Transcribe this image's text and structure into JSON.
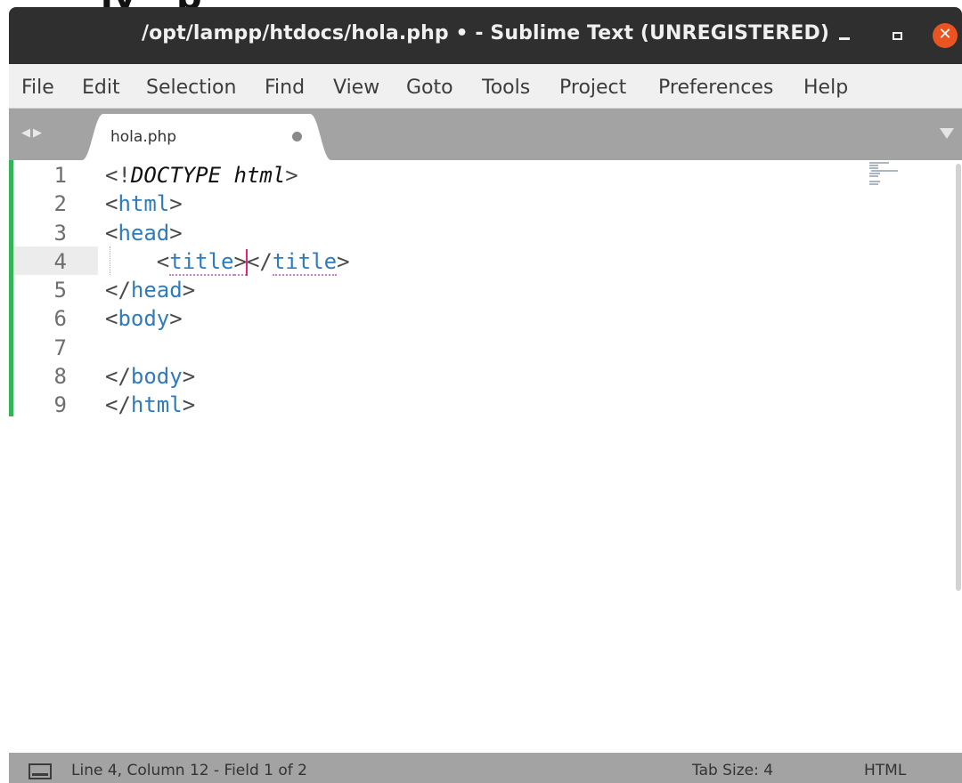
{
  "window": {
    "title": "/opt/lampp/htdocs/hola.php • - Sublime Text (UNREGISTERED)",
    "close_glyph": "✕"
  },
  "menu": [
    "File",
    "Edit",
    "Selection",
    "Find",
    "View",
    "Goto",
    "Tools",
    "Project",
    "Preferences",
    "Help"
  ],
  "tabs": [
    {
      "label": "hola.php",
      "modified": true
    }
  ],
  "editor": {
    "line_numbers": [
      "1",
      "2",
      "3",
      "4",
      "5",
      "6",
      "7",
      "8",
      "9"
    ],
    "current_line": "4",
    "lines": [
      "<!DOCTYPE html>",
      "<html>",
      "<head>",
      "    <title></title>",
      "</head>",
      "<body>",
      "",
      "</body>",
      "</html>"
    ],
    "tokens": {
      "lt": "<",
      "gt": ">",
      "ltslash": "</",
      "bang": "!",
      "doctype": "DOCTYPE html",
      "html": "html",
      "head": "head",
      "title": "title",
      "body": "body",
      "indent": "    "
    }
  },
  "statusbar": {
    "position": "Line 4, Column 12 - Field 1 of 2",
    "tab_size": "Tab Size: 4",
    "syntax": "HTML"
  },
  "colors": {
    "titlebar": "#2f2f2f",
    "close_button": "#e95420",
    "tag_name": "#2f7cbc",
    "caret": "#e0257b",
    "git_modified": "#35b357",
    "chrome_gray": "#a3a3a3"
  }
}
